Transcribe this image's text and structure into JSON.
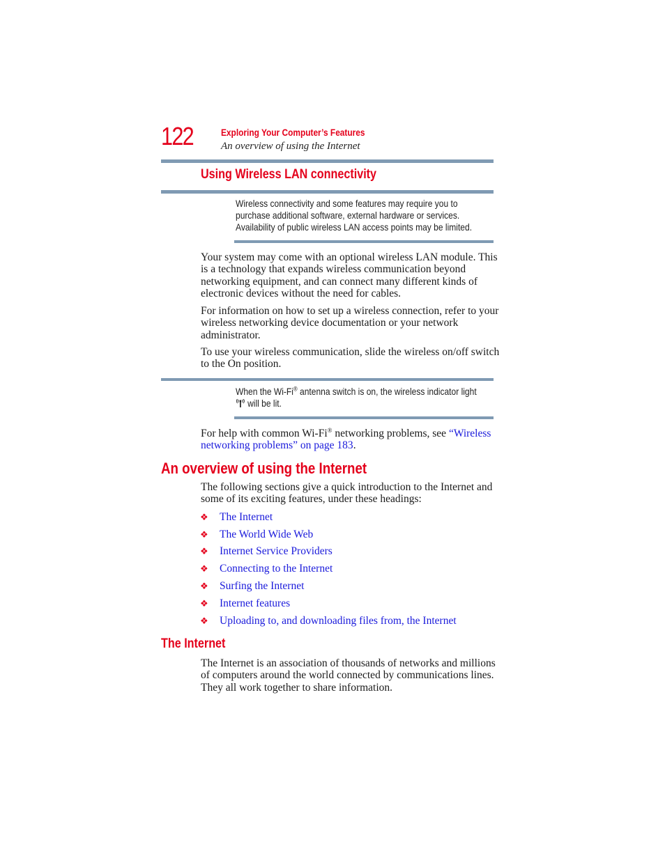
{
  "header": {
    "page_number": "122",
    "chapter_title": "Exploring Your Computer’s Features",
    "section_subtitle": "An overview of using the Internet"
  },
  "wireless_section": {
    "heading": "Using Wireless LAN connectivity",
    "note1": {
      "lines": [
        "Wireless connectivity and some features may require you to",
        "purchase additional software, external hardware or services.",
        "Availability of public wireless LAN access points may be limited."
      ]
    },
    "paragraphs": [
      "Your system may come with an optional wireless LAN module. This is a technology that expands wireless communication beyond networking equipment, and can connect many different kinds of electronic devices without the need for cables.",
      "For information on how to set up a wireless connection, refer to your wireless networking device documentation or your network administrator.",
      "To use your wireless communication, slide the wireless on/off switch to the On position."
    ],
    "note2": {
      "line1_pre": "When the Wi-Fi",
      "line1_sup": "®",
      "line1_post": " antenna switch is on, the wireless indicator light",
      "icon": "wireless-indicator-icon",
      "line2": " will be lit."
    },
    "help": {
      "pre": "For help with common Wi-Fi",
      "sup": "®",
      "mid": " networking problems, see ",
      "link": "“Wireless networking problems” on page 183",
      "post": "."
    }
  },
  "overview_section": {
    "heading": "An overview of using the Internet",
    "intro": "The following sections give a quick introduction to the Internet and some of its exciting features, under these headings:",
    "bullet_glyph": "❖",
    "items": [
      "The Internet",
      "The World Wide Web",
      "Internet Service Providers",
      "Connecting to the Internet",
      "Surfing the Internet",
      "Internet features",
      "Uploading to, and downloading files from, the Internet"
    ]
  },
  "internet_section": {
    "heading": "The Internet",
    "paragraph": "The Internet is an association of thousands of networks and millions of computers around the world connected by communications lines. They all work together to share information."
  },
  "colors": {
    "accent_red": "#e4001b",
    "rule_blue_gray": "#7f9ab3",
    "link_blue": "#1a1adb"
  }
}
